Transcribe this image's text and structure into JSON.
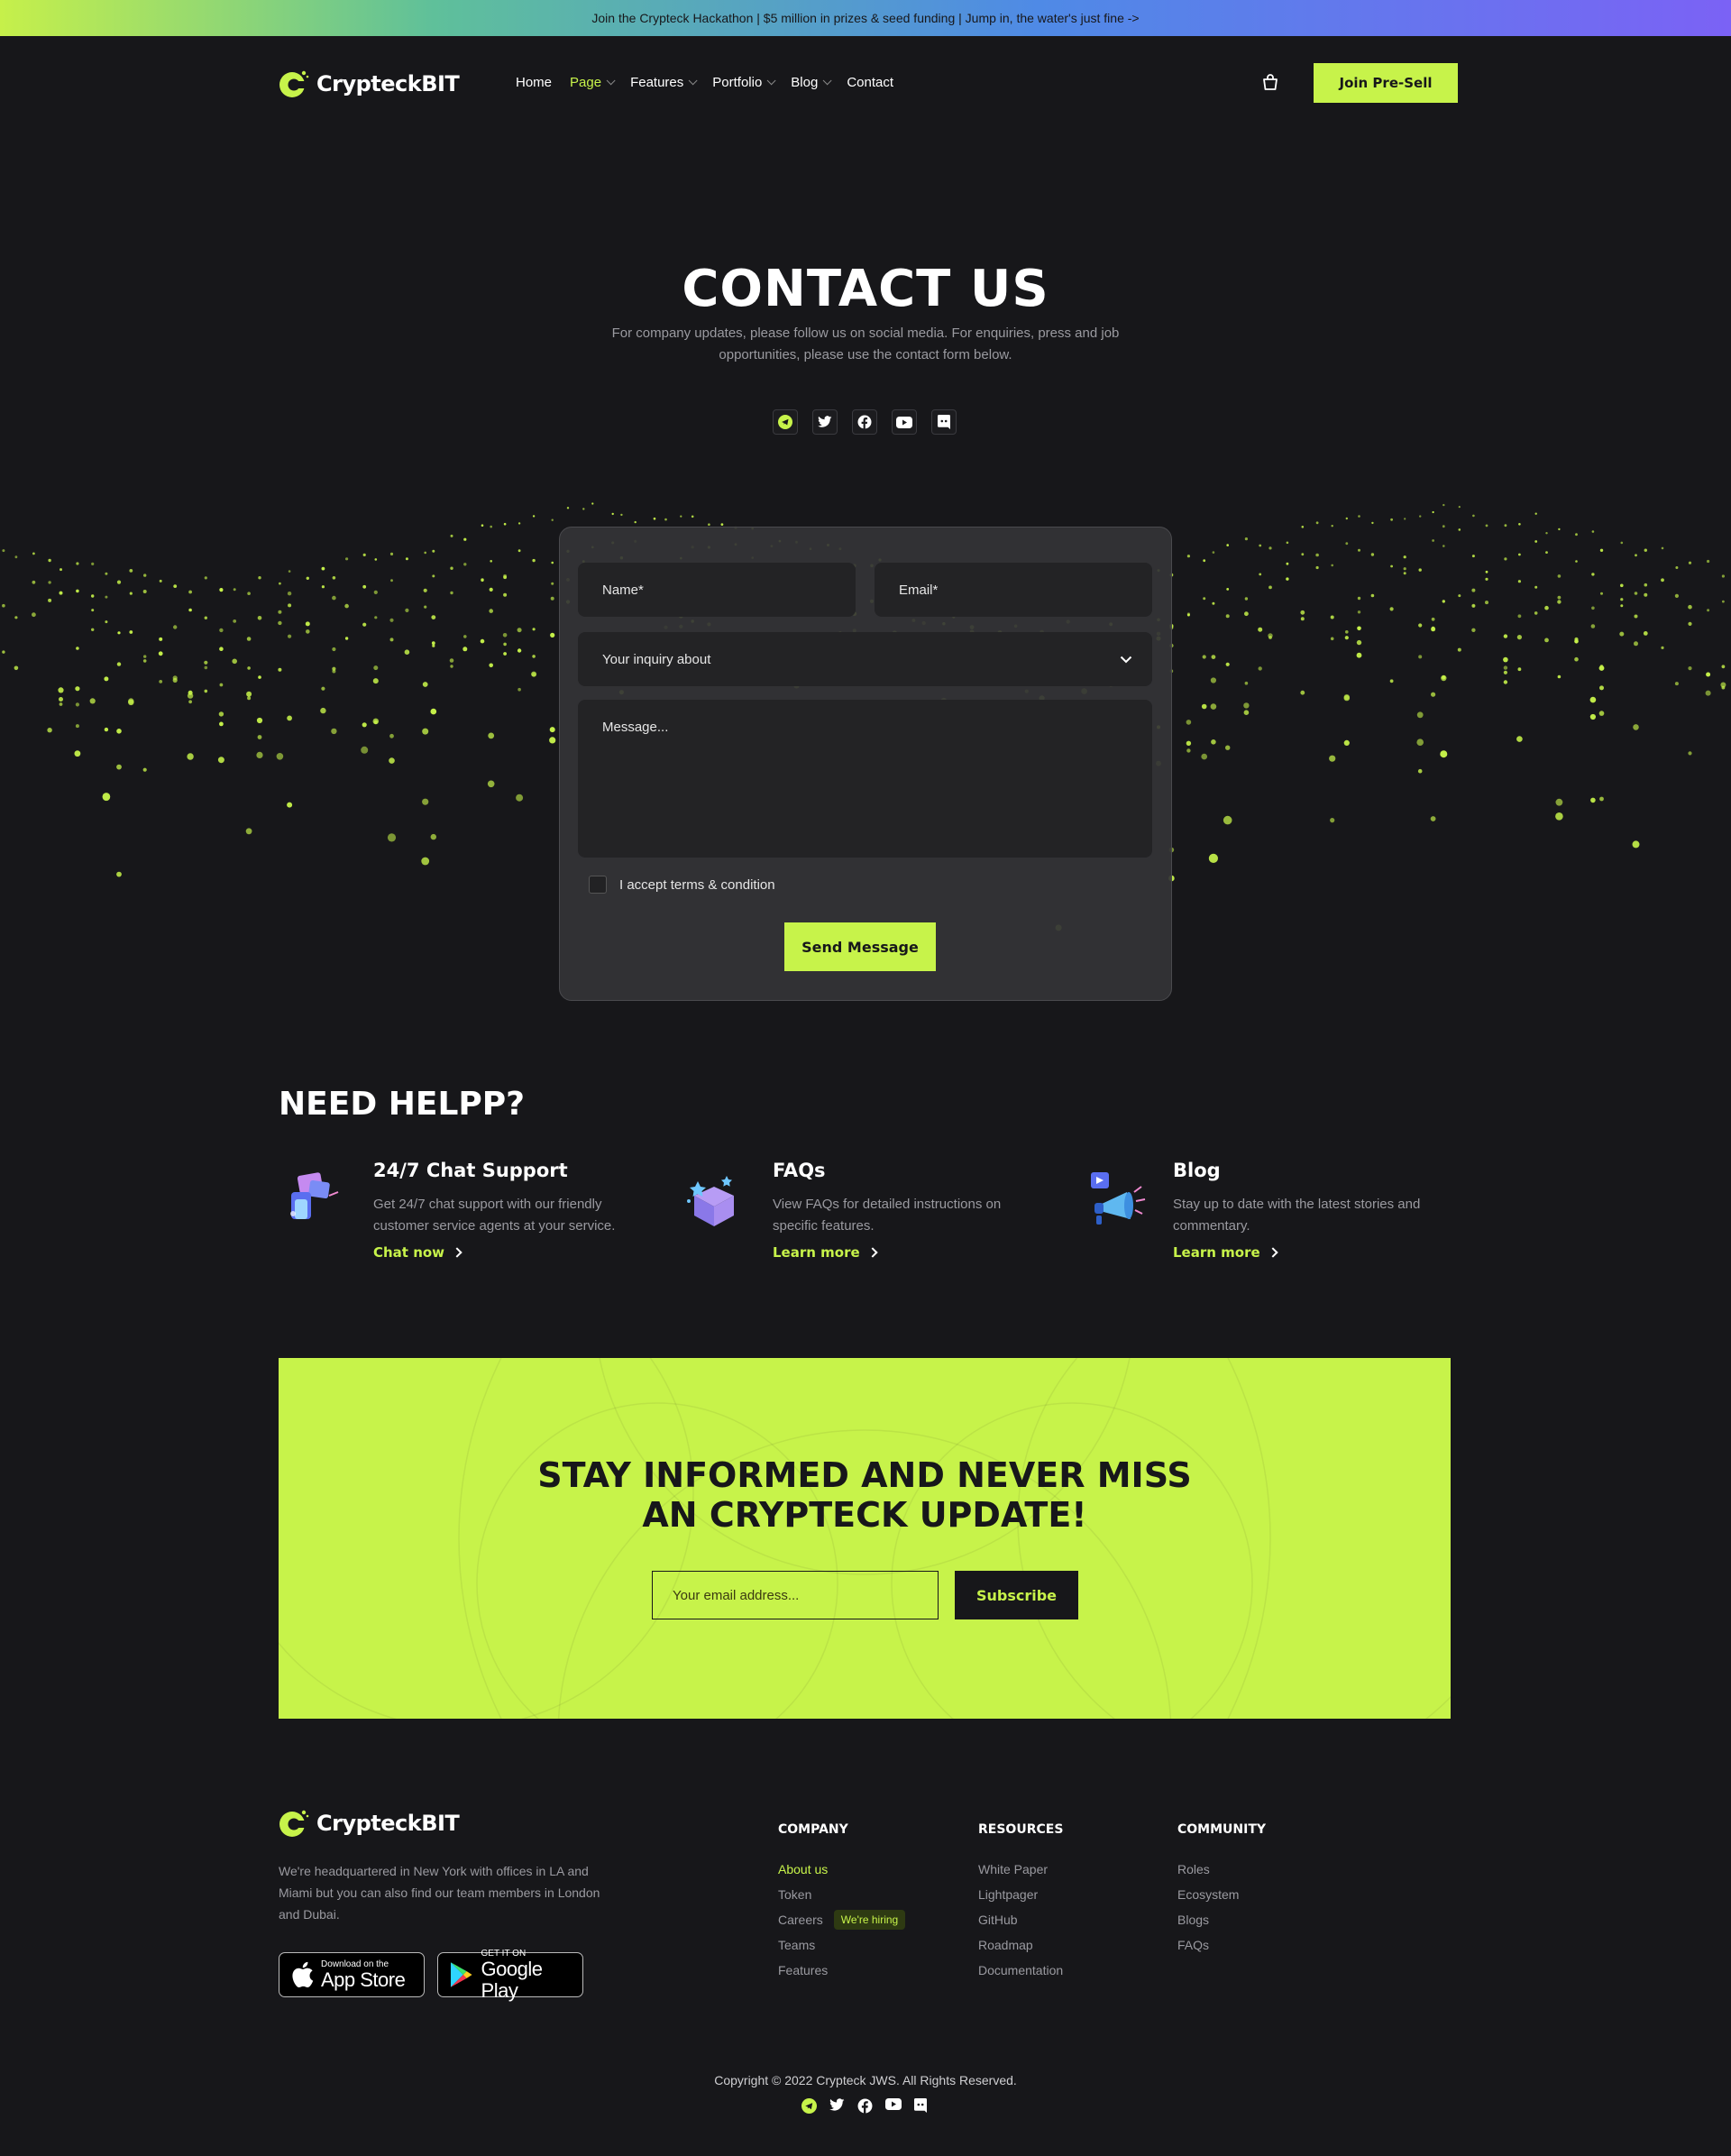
{
  "announcement": "Join the Crypteck Hackathon | $5 million in prizes & seed funding | Jump in, the water's just fine ->",
  "brand": {
    "name": "CrypteckBIT",
    "accent": "#c7f34a",
    "background": "#17171a"
  },
  "nav": {
    "items": [
      {
        "label": "Home"
      },
      {
        "label": "Page"
      },
      {
        "label": "Features"
      },
      {
        "label": "Portfolio"
      },
      {
        "label": "Blog"
      },
      {
        "label": "Contact"
      }
    ],
    "cta": "Join Pre-Sell",
    "cart_icon": "cart-icon"
  },
  "hero": {
    "title": "CONTACT US",
    "subtitle": "For company updates, please follow us on social media. For enquiries, press and job opportunities, please use the contact form below.",
    "socials": [
      "telegram-icon",
      "twitter-icon",
      "facebook-icon",
      "youtube-icon",
      "discord-icon"
    ]
  },
  "form": {
    "name_placeholder": "Name*",
    "email_placeholder": "Email*",
    "inquiry_placeholder": "Your inquiry about",
    "message_placeholder": "Message...",
    "terms_label": "I accept terms & condition",
    "send_label": "Send Message"
  },
  "help": {
    "title": "NEED HELPP?",
    "items": [
      {
        "title": "24/7 Chat Support",
        "text": "Get 24/7 chat support with our friendly customer service agents at your service.",
        "link": "Chat now",
        "icon": "chat-support-icon"
      },
      {
        "title": "FAQs",
        "text": "View FAQs for detailed instructions on specific features.",
        "link": "Learn more",
        "icon": "faq-box-icon"
      },
      {
        "title": "Blog",
        "text": "Stay up to date with the latest stories and commentary.",
        "link": "Learn more",
        "icon": "megaphone-icon"
      }
    ]
  },
  "newsletter": {
    "title_line1": "STAY INFORMED AND NEVER MISS",
    "title_line2": "AN CRYPTECK UPDATE!",
    "placeholder": "Your email address...",
    "button": "Subscribe"
  },
  "footer": {
    "description": "We're headquartered in New York with offices in LA and Miami but you can also find our team members in London and Dubai.",
    "app_store": {
      "small": "Download on the",
      "big": "App Store"
    },
    "google_play": {
      "small": "GET IT ON",
      "big": "Google Play"
    },
    "columns": [
      {
        "title": "COMPANY",
        "items": [
          "About us",
          "Token",
          "Careers",
          "Teams",
          "Features"
        ],
        "badge": "We're hiring"
      },
      {
        "title": "RESOURCES",
        "items": [
          "White Paper",
          "Lightpager",
          "GitHub",
          "Roadmap",
          "Documentation"
        ]
      },
      {
        "title": "COMMUNITY",
        "items": [
          "Roles",
          "Ecosystem",
          "Blogs",
          "FAQs"
        ]
      }
    ],
    "copyright": "Copyright © 2022 Crypteck JWS. All Rights Reserved."
  }
}
